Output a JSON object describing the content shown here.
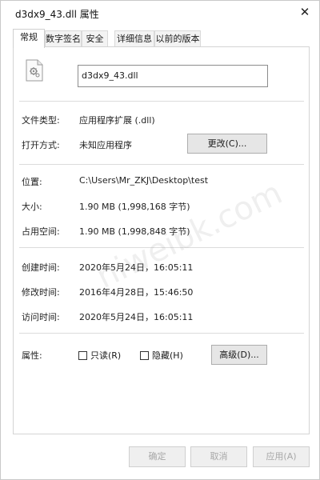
{
  "window": {
    "title": "d3dx9_43.dll 属性",
    "close_symbol": "✕"
  },
  "tabs": [
    {
      "label": "常规"
    },
    {
      "label": "数字签名"
    },
    {
      "label": "安全"
    },
    {
      "label": "详细信息"
    },
    {
      "label": "以前的版本"
    }
  ],
  "file": {
    "name": "d3dx9_43.dll",
    "icon": "dll-file-icon"
  },
  "info": {
    "type_label": "文件类型:",
    "type_value": "应用程序扩展 (.dll)",
    "open_label": "打开方式:",
    "open_value": "未知应用程序",
    "change_button": "更改(C)...",
    "location_label": "位置:",
    "location_value": "C:\\Users\\Mr_ZKJ\\Desktop\\test",
    "size_label": "大小:",
    "size_value": "1.90 MB (1,998,168 字节)",
    "disk_label": "占用空间:",
    "disk_value": "1.90 MB (1,998,848 字节)",
    "created_label": "创建时间:",
    "created_value": "2020年5月24日，16:05:11",
    "modified_label": "修改时间:",
    "modified_value": "2016年4月28日，15:46:50",
    "accessed_label": "访问时间:",
    "accessed_value": "2020年5月24日，16:05:11",
    "attr_label": "属性:",
    "readonly_label": "只读(R)",
    "readonly_checked": false,
    "hidden_label": "隐藏(H)",
    "hidden_checked": false,
    "advanced_button": "高级(D)..."
  },
  "footer": {
    "ok": "确定",
    "cancel": "取消",
    "apply": "应用(A)"
  },
  "watermark": "niweibk.com"
}
